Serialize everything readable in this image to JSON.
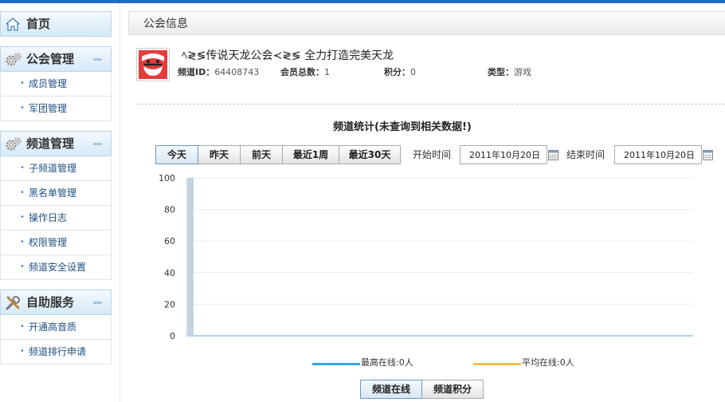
{
  "sidebar": {
    "home_label": "首页",
    "sections": [
      {
        "title": "公会管理",
        "icon": "gear-icon",
        "items": [
          "成员管理",
          "军团管理"
        ]
      },
      {
        "title": "频道管理",
        "icon": "gear-icon",
        "items": [
          "子频道管理",
          "黑名单管理",
          "操作日志",
          "权限管理",
          "频道安全设置"
        ]
      },
      {
        "title": "自助服务",
        "icon": "tools-icon",
        "items": [
          "开通高音质",
          "频道排行申请"
        ]
      }
    ]
  },
  "panel": {
    "title": "公会信息",
    "guild_name": "ﾍ≷≶传说天龙公会≺≷≶ 全力打造完美天龙",
    "channel_id_label": "频道ID：",
    "channel_id": "64408743",
    "members_label": "会员总数：",
    "members": "1",
    "points_label": "积分：",
    "points": "0",
    "type_label": "类型：",
    "type": "游戏"
  },
  "stats": {
    "title": "频道统计(未查询到相关数据!)",
    "tabs": [
      "今天",
      "昨天",
      "前天",
      "最近1周",
      "最近30天"
    ],
    "active_tab": 0,
    "start_label": "开始时间",
    "start_date": "2011年10月20日",
    "end_label": "结束时间",
    "end_date": "2011年10月20日",
    "bottom_tabs": [
      "频道在线",
      "频道积分"
    ],
    "active_bottom_tab": 0
  },
  "colors": {
    "accent": "#1c6fc4",
    "bar": "#c3d3e3",
    "series_max": "#3aa3e3",
    "series_avg": "#f5c04a"
  },
  "chart_data": {
    "type": "bar",
    "categories": [
      ""
    ],
    "ylim": [
      0,
      100
    ],
    "yticks": [
      0,
      20,
      40,
      60,
      80,
      100
    ],
    "series": [
      {
        "name": "最高在线:0人",
        "values": [
          100
        ]
      }
    ],
    "legend": [
      {
        "label": "最高在线:0人",
        "color": "#3aa3e3"
      },
      {
        "label": "平均在线:0人",
        "color": "#f5c04a"
      }
    ],
    "grid": true
  }
}
